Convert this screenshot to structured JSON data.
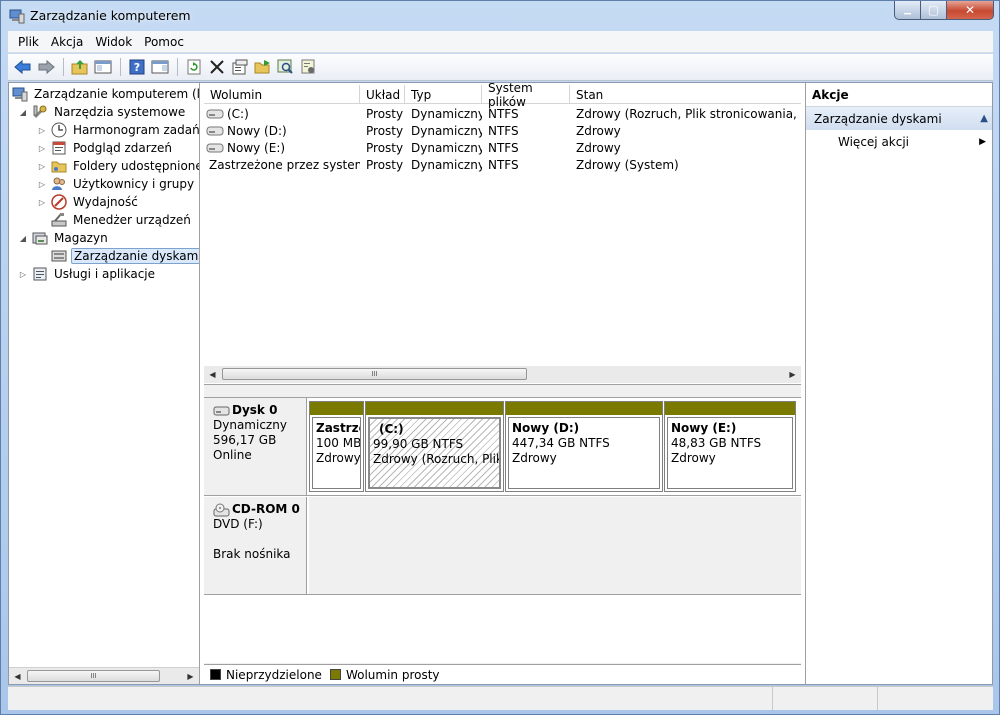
{
  "window": {
    "title": "Zarządzanie komputerem",
    "minimize_glyph": "▁",
    "maximize_glyph": "▢",
    "close_glyph": "✕"
  },
  "menu": {
    "items": [
      "Plik",
      "Akcja",
      "Widok",
      "Pomoc"
    ]
  },
  "toolbar": {
    "buttons": [
      "back-icon",
      "forward-icon",
      "up-folder-icon",
      "show-hide-tree-icon",
      "help-icon",
      "show-hide-action-pane-icon",
      "refresh-icon",
      "delete-icon",
      "properties-icon",
      "open-folder-icon",
      "search-icon",
      "settings-icon"
    ]
  },
  "tree": {
    "root": "Zarządzanie komputerem (lokalny)",
    "system_tools": "Narzędzia systemowe",
    "task_scheduler": "Harmonogram zadań",
    "event_viewer": "Podgląd zdarzeń",
    "shared_folders": "Foldery udostępnione",
    "users_groups": "Użytkownicy i grupy lokalne",
    "performance": "Wydajność",
    "device_manager": "Menedżer urządzeń",
    "storage": "Magazyn",
    "disk_management": "Zarządzanie dyskami",
    "services_apps": "Usługi i aplikacje",
    "scroll_thumb": "III"
  },
  "volumes": {
    "columns": [
      "Wolumin",
      "Układ",
      "Typ",
      "System plików",
      "Stan"
    ],
    "rows": [
      {
        "name": "(C:)",
        "layout": "Prosty",
        "type": "Dynamiczny",
        "fs": "NTFS",
        "status": "Zdrowy (Rozruch, Plik stronicowania, Zrzut awaryjny)"
      },
      {
        "name": "Nowy (D:)",
        "layout": "Prosty",
        "type": "Dynamiczny",
        "fs": "NTFS",
        "status": "Zdrowy"
      },
      {
        "name": "Nowy (E:)",
        "layout": "Prosty",
        "type": "Dynamiczny",
        "fs": "NTFS",
        "status": "Zdrowy"
      },
      {
        "name": "Zastrzeżone przez system",
        "layout": "Prosty",
        "type": "Dynamiczny",
        "fs": "NTFS",
        "status": "Zdrowy (System)"
      }
    ],
    "scroll_thumb": "III"
  },
  "disks": {
    "disk0": {
      "name": "Dysk 0",
      "type": "Dynamiczny",
      "size": "596,17 GB",
      "state": "Online",
      "partitions": [
        {
          "name": "Zastrzeżone przez system",
          "size": "100 MB",
          "status": "Zdrowy"
        },
        {
          "name": "(C:)",
          "size": "99,90 GB NTFS",
          "status": "Zdrowy (Rozruch, Plik stronicowania, Zrzut awaryjny)"
        },
        {
          "name": "Nowy  (D:)",
          "size": "447,34 GB NTFS",
          "status": "Zdrowy"
        },
        {
          "name": "Nowy  (E:)",
          "size": "48,83 GB NTFS",
          "status": "Zdrowy"
        }
      ]
    },
    "cdrom0": {
      "name": "CD-ROM 0",
      "drive": "DVD (F:)",
      "media": "Brak nośnika"
    }
  },
  "legend": {
    "unallocated": "Nieprzydzielone",
    "simple_volume": "Wolumin prosty",
    "unallocated_color": "#000000",
    "simple_volume_color": "#7a7a00"
  },
  "actions": {
    "header": "Akcje",
    "section": "Zarządzanie dyskami",
    "more": "Więcej akcji"
  }
}
